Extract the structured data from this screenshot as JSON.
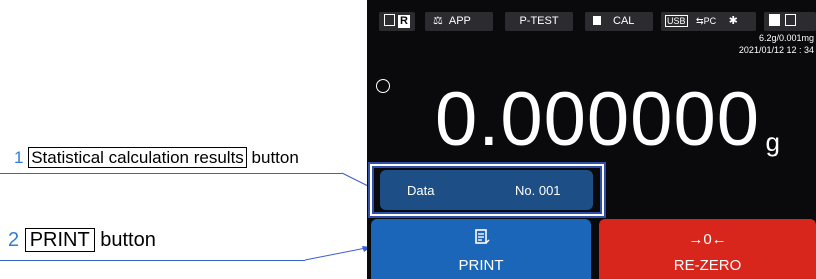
{
  "callouts": [
    {
      "number": "1",
      "boxed_text": "Statistical calculation results",
      "suffix": "button"
    },
    {
      "number": "2",
      "boxed_text": "PRINT",
      "suffix": "button"
    }
  ],
  "topbar": {
    "chip1_label": "R",
    "app_label": "APP",
    "ptest_label": "P-TEST",
    "cal_label": "CAL",
    "usb_label": "USB",
    "pc_label": "PC",
    "bluetooth_glyph": "✱"
  },
  "status": {
    "capacity": "6.2g/0.001mg",
    "datetime": "2021/01/12  12 : 34"
  },
  "display": {
    "reading": "0.000000",
    "unit": "g"
  },
  "stats_button": {
    "data_label": "Data",
    "number_label": "No. 001"
  },
  "print_button": {
    "label": "PRINT"
  },
  "rezero_button": {
    "symbol": "→0←",
    "label": "RE-ZERO"
  },
  "colors": {
    "screen_bg": "#0a0a0c",
    "chip_bg": "#2c2c30",
    "stats_blue": "#1d4f86",
    "print_blue": "#1b66b8",
    "rezero_red": "#d9261c",
    "callout_number": "#2f7fd6"
  }
}
